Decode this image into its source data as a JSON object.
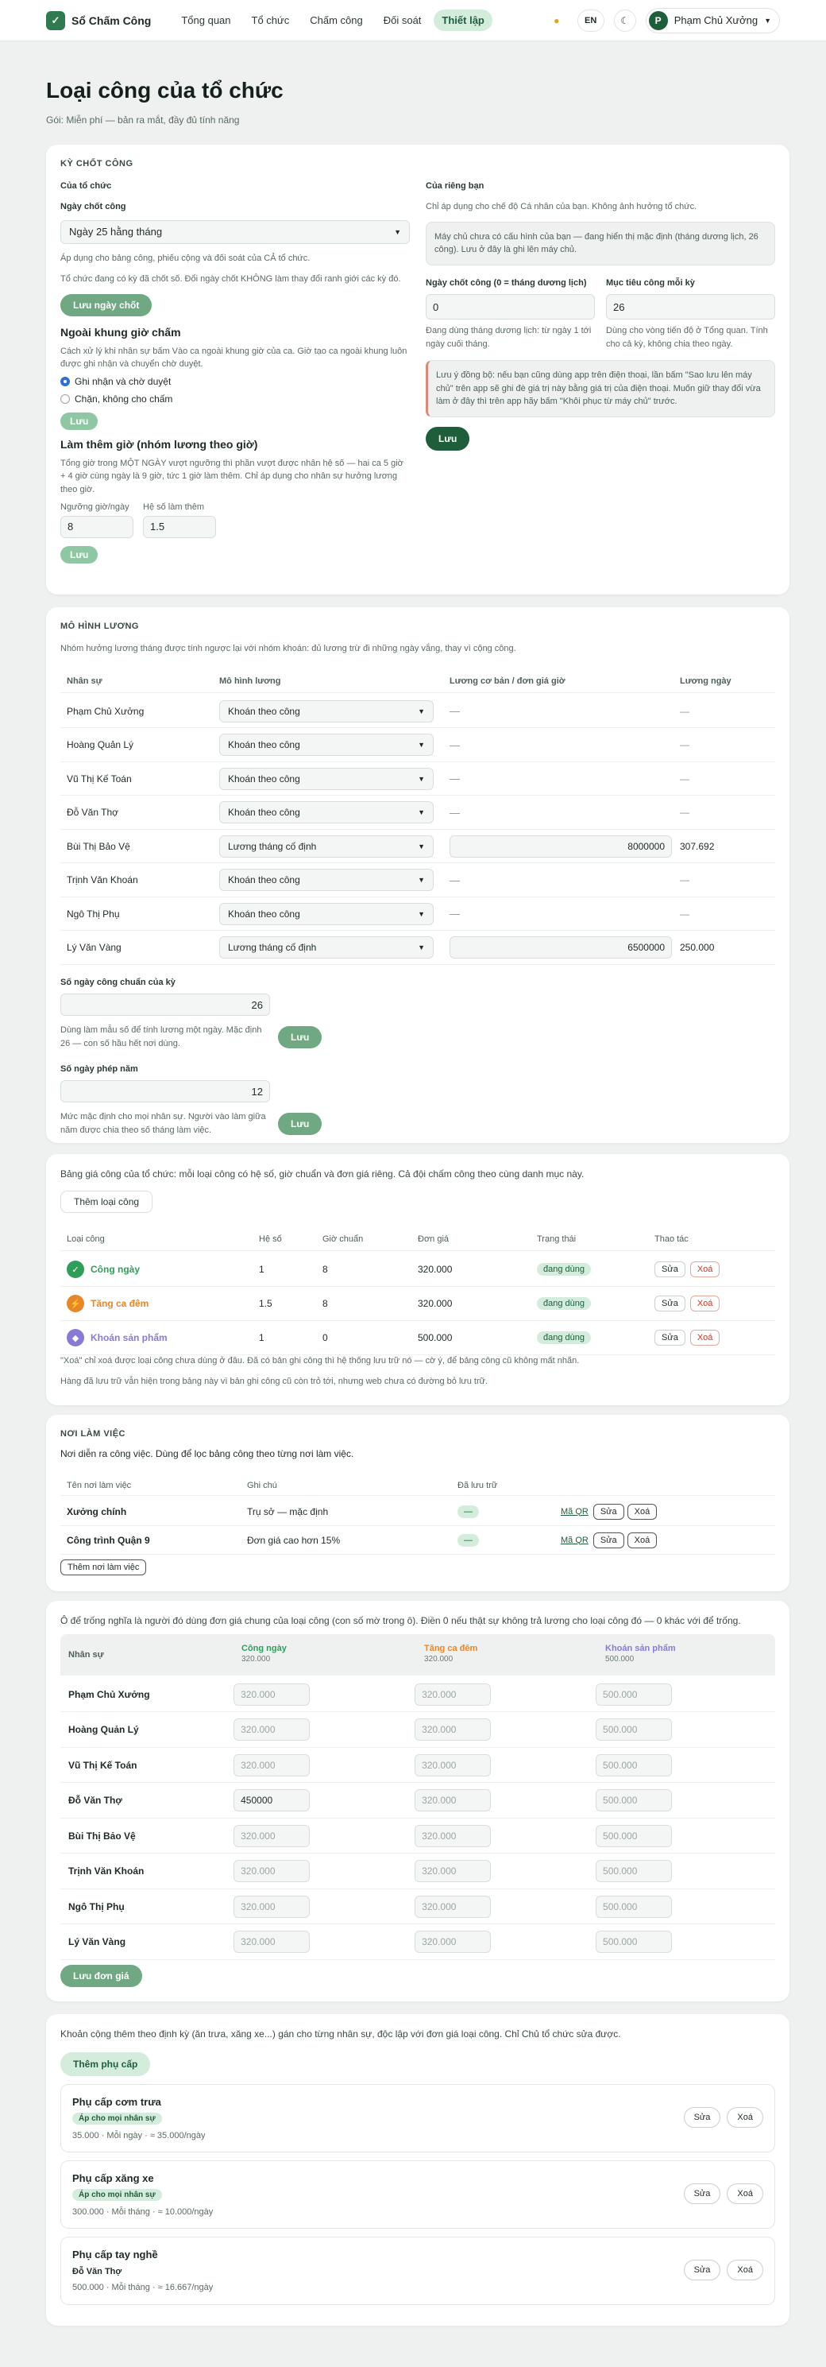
{
  "app": {
    "name": "Sổ Chấm Công",
    "nav": [
      "Tổng quan",
      "Tổ chức",
      "Chấm công",
      "Đối soát",
      "Thiết lập"
    ],
    "lang": "EN",
    "user": "Phạm Chủ Xưởng",
    "avatar": "P",
    "bell_icon": "bell-icon",
    "theme_icon": "moon-icon"
  },
  "page": {
    "title": "Loại công của tổ chức",
    "subtitle": "Gói: Miễn phí — bản ra mắt, đầy đủ tính năng"
  },
  "cutoff": {
    "section": "KỲ CHỐT CÔNG",
    "org": {
      "title": "Của tổ chức",
      "day_label": "Ngày chốt công",
      "day_value": "Ngày 25 hằng tháng",
      "hint1": "Áp dụng cho bảng công, phiếu cộng và đối soát của CẢ tổ chức.",
      "hint2": "Tổ chức đang có kỳ đã chốt số. Đổi ngày chốt KHÔNG làm thay đổi ranh giới các kỳ đó.",
      "save": "Lưu ngày chốt"
    },
    "personal": {
      "title": "Của riêng bạn",
      "desc": "Chỉ áp dụng cho chế độ Cá nhân của bạn. Không ảnh hưởng tổ chức.",
      "note": "Máy chủ chưa có cấu hình của bạn — đang hiển thị mặc định (tháng dương lịch, 26 công). Lưu ở đây là ghi lên máy chủ.",
      "day_label": "Ngày chốt công (0 = tháng dương lịch)",
      "day_value": "0",
      "day_hint": "Đang dùng tháng dương lịch: từ ngày 1 tới ngày cuối tháng.",
      "target_label": "Mục tiêu công mỗi kỳ",
      "target_value": "26",
      "target_hint": "Dùng cho vòng tiến độ ở Tổng quan. Tính cho cả kỳ, không chia theo ngày.",
      "warn": "Lưu ý đồng bộ: nếu bạn cũng dùng app trên điện thoại, lần bấm \"Sao lưu lên máy chủ\" trên app sẽ ghi đè giá trị này bằng giá trị của điện thoại. Muốn giữ thay đổi vừa làm ở đây thì trên app hãy bấm \"Khôi phục từ máy chủ\" trước.",
      "save": "Lưu"
    },
    "outside": {
      "title": "Ngoài khung giờ chấm",
      "desc": "Cách xử lý khi nhân sự bấm Vào ca ngoài khung giờ của ca. Giờ tạo ca ngoài khung luôn được ghi nhận và chuyển chờ duyệt.",
      "opt1": "Ghi nhận và chờ duyệt",
      "opt2": "Chặn, không cho chấm",
      "save": "Lưu"
    },
    "overtime": {
      "title": "Làm thêm giờ (nhóm lương theo giờ)",
      "desc": "Tổng giờ trong MỘT NGÀY vượt ngưỡng thì phần vượt được nhân hệ số — hai ca 5 giờ + 4 giờ cùng ngày là 9 giờ, tức 1 giờ làm thêm. Chỉ áp dụng cho nhân sự hưởng lương theo giờ.",
      "thr_label": "Ngưỡng giờ/ngày",
      "thr_value": "8",
      "coef_label": "Hệ số làm thêm",
      "coef_value": "1.5",
      "save": "Lưu"
    }
  },
  "salary": {
    "section": "MÔ HÌNH LƯƠNG",
    "desc": "Nhóm hưởng lương tháng được tính ngược lại với nhóm khoán: đủ lương trừ đi những ngày vắng, thay vì cộng công.",
    "headers": [
      "Nhân sự",
      "Mô hình lương",
      "Lương cơ bản / đơn giá giờ",
      "Lương ngày"
    ],
    "rows": [
      {
        "name": "Phạm Chủ Xưởng",
        "model": "Khoán theo công",
        "base": "—",
        "daily": "—"
      },
      {
        "name": "Hoàng Quản Lý",
        "model": "Khoán theo công",
        "base": "—",
        "daily": "—"
      },
      {
        "name": "Vũ Thị Kế Toán",
        "model": "Khoán theo công",
        "base": "—",
        "daily": "—"
      },
      {
        "name": "Đỗ Văn Thợ",
        "model": "Khoán theo công",
        "base": "—",
        "daily": "—"
      },
      {
        "name": "Bùi Thị Bảo Vệ",
        "model": "Lương tháng cố định",
        "base": "8000000",
        "daily": "307.692"
      },
      {
        "name": "Trịnh Văn Khoán",
        "model": "Khoán theo công",
        "base": "—",
        "daily": "—"
      },
      {
        "name": "Ngô Thị Phụ",
        "model": "Khoán theo công",
        "base": "—",
        "daily": "—"
      },
      {
        "name": "Lý Văn Vàng",
        "model": "Lương tháng cố định",
        "base": "6500000",
        "daily": "250.000"
      }
    ],
    "std_label": "Số ngày công chuẩn của kỳ",
    "std_value": "26",
    "std_hint": "Dùng làm mẫu số để tính lương một ngày. Mặc định 26 — con số hầu hết nơi dùng.",
    "std_save": "Lưu",
    "leave_label": "Số ngày phép năm",
    "leave_value": "12",
    "leave_hint": "Mức mặc định cho mọi nhân sự. Người vào làm giữa năm được chia theo số tháng làm việc.",
    "leave_save": "Lưu"
  },
  "types": {
    "desc": "Bảng giá công của tổ chức: mỗi loại công có hệ số, giờ chuẩn và đơn giá riêng. Cả đội chấm công theo cùng danh mục này.",
    "add": "Thêm loại công",
    "headers": [
      "Loại công",
      "Hệ số",
      "Giờ chuẩn",
      "Đơn giá",
      "Trạng thái",
      "Thao tác"
    ],
    "rows": [
      {
        "name": "Công ngày",
        "icon": "check-icon",
        "color": "#2f9e5b",
        "coef": "1",
        "hours": "8",
        "price": "320.000",
        "status": "đang dùng"
      },
      {
        "name": "Tăng ca đêm",
        "icon": "bolt-icon",
        "color": "#e8862a",
        "coef": "1.5",
        "hours": "8",
        "price": "320.000",
        "status": "đang dùng"
      },
      {
        "name": "Khoán sản phẩm",
        "icon": "box-icon",
        "color": "#8a7ad6",
        "coef": "1",
        "hours": "0",
        "price": "500.000",
        "status": "đang dùng"
      }
    ],
    "edit": "Sửa",
    "del": "Xoá",
    "foot1": "\"Xoá\" chỉ xoá được loại công chưa dùng ở đâu. Đã có bản ghi công thì hệ thống lưu trữ nó — cờ ý, để bảng công cũ không mất nhãn.",
    "foot2": "Hàng đã lưu trữ vẫn hiện trong bảng này vì bản ghi công cũ còn trỏ tới, nhưng web chưa có đường bỏ lưu trữ."
  },
  "places": {
    "section": "NƠI LÀM VIỆC",
    "desc": "Nơi diễn ra công việc. Dùng để lọc bảng công theo từng nơi làm việc.",
    "headers": [
      "Tên nơi làm việc",
      "Ghi chú",
      "Đã lưu trữ"
    ],
    "rows": [
      {
        "name": "Xưởng chính",
        "note": "Trụ sở — mặc định",
        "archived": "—"
      },
      {
        "name": "Công trình Quận 9",
        "note": "Đơn giá cao hơn 15%",
        "archived": "—"
      }
    ],
    "qr": "Mã QR",
    "edit": "Sửa",
    "del": "Xoá",
    "add": "Thêm nơi làm việc"
  },
  "prices": {
    "desc": "Ô để trống nghĩa là người đó dùng đơn giá chung của loại công (con số mờ trong ô). Điền 0 nếu thật sự không trả lương cho loại công đó — 0 khác với để trống.",
    "col0": "Nhân sự",
    "cols": [
      {
        "name": "Công ngày",
        "price": "320.000",
        "color": "#2f9e5b"
      },
      {
        "name": "Tăng ca đêm",
        "price": "320.000",
        "color": "#e8862a"
      },
      {
        "name": "Khoán sản phẩm",
        "price": "500.000",
        "color": "#8a7ad6"
      }
    ],
    "rows": [
      {
        "name": "Phạm Chủ Xưởng",
        "v": [
          "320.000",
          "320.000",
          "500.000"
        ],
        "filled": [
          false,
          false,
          false
        ]
      },
      {
        "name": "Hoàng Quản Lý",
        "v": [
          "320.000",
          "320.000",
          "500.000"
        ],
        "filled": [
          false,
          false,
          false
        ]
      },
      {
        "name": "Vũ Thị Kế Toán",
        "v": [
          "320.000",
          "320.000",
          "500.000"
        ],
        "filled": [
          false,
          false,
          false
        ]
      },
      {
        "name": "Đỗ Văn Thợ",
        "v": [
          "450000",
          "320.000",
          "500.000"
        ],
        "filled": [
          true,
          false,
          false
        ]
      },
      {
        "name": "Bùi Thị Bảo Vệ",
        "v": [
          "320.000",
          "320.000",
          "500.000"
        ],
        "filled": [
          false,
          false,
          false
        ]
      },
      {
        "name": "Trịnh Văn Khoán",
        "v": [
          "320.000",
          "320.000",
          "500.000"
        ],
        "filled": [
          false,
          false,
          false
        ]
      },
      {
        "name": "Ngô Thị Phụ",
        "v": [
          "320.000",
          "320.000",
          "500.000"
        ],
        "filled": [
          false,
          false,
          false
        ]
      },
      {
        "name": "Lý Văn Vàng",
        "v": [
          "320.000",
          "320.000",
          "500.000"
        ],
        "filled": [
          false,
          false,
          false
        ]
      }
    ],
    "save": "Lưu đơn giá"
  },
  "allow": {
    "desc": "Khoản cộng thêm theo định kỳ (ăn trưa, xăng xe...) gán cho từng nhân sự, độc lập với đơn giá loại công. Chỉ Chủ tổ chức sửa được.",
    "add": "Thêm phụ cấp",
    "items": [
      {
        "name": "Phụ cấp cơm trưa",
        "scope": "Áp cho mọi nhân sự",
        "badge": true,
        "detail": "35.000 · Mỗi ngày · ≈ 35.000/ngày"
      },
      {
        "name": "Phụ cấp xăng xe",
        "scope": "Áp cho mọi nhân sự",
        "badge": true,
        "detail": "300.000 · Mỗi tháng · ≈ 10.000/ngày"
      },
      {
        "name": "Phụ cấp tay nghề",
        "scope": "Đỗ Văn Thợ",
        "badge": false,
        "detail": "500.000 · Mỗi tháng · ≈ 16.667/ngày"
      }
    ],
    "edit": "Sửa",
    "del": "Xoá"
  }
}
